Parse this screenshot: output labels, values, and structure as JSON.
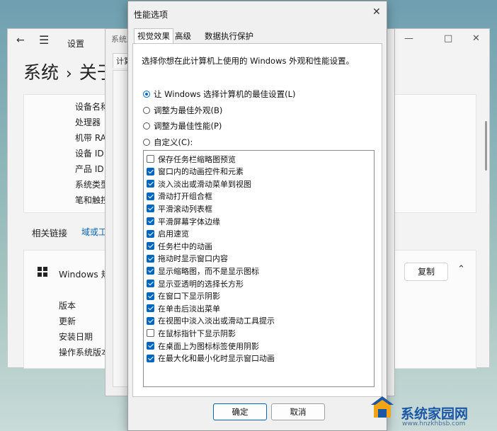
{
  "settings_window": {
    "app_title": "设置",
    "breadcrumb": [
      "系统",
      "关于"
    ],
    "spec_labels": [
      "设备名称",
      "处理器",
      "机带 RAM",
      "设备 ID",
      "产品 ID",
      "系统类型",
      "笔和触控"
    ],
    "related_label": "相关链接",
    "related_link": "域或工作组",
    "windows_spec_title": "Windows 规格",
    "copy_button": "复制",
    "windows_spec_labels": [
      "版本",
      "更新",
      "安装日期",
      "操作系统版本"
    ]
  },
  "system_properties": {
    "title": "系统属性",
    "tab": "计算机名"
  },
  "dialog": {
    "title": "性能选项",
    "tabs": [
      "视觉效果",
      "高级",
      "数据执行保护"
    ],
    "description": "选择你想在此计算机上使用的 Windows 外观和性能设置。",
    "radios": [
      {
        "label": "让 Windows 选择计算机的最佳设置(L)",
        "checked": true
      },
      {
        "label": "调整为最佳外观(B)",
        "checked": false
      },
      {
        "label": "调整为最佳性能(P)",
        "checked": false
      },
      {
        "label": "自定义(C):",
        "checked": false
      }
    ],
    "options": [
      {
        "label": "保存任务栏缩略图预览",
        "checked": false
      },
      {
        "label": "窗口内的动画控件和元素",
        "checked": true
      },
      {
        "label": "淡入淡出或滑动菜单到视图",
        "checked": true
      },
      {
        "label": "滑动打开组合框",
        "checked": true
      },
      {
        "label": "平滑滚动列表框",
        "checked": true
      },
      {
        "label": "平滑屏幕字体边缘",
        "checked": true
      },
      {
        "label": "启用速览",
        "checked": true
      },
      {
        "label": "任务栏中的动画",
        "checked": true
      },
      {
        "label": "拖动时显示窗口内容",
        "checked": true
      },
      {
        "label": "显示缩略图，而不是显示图标",
        "checked": true
      },
      {
        "label": "显示亚透明的选择长方形",
        "checked": true
      },
      {
        "label": "在窗口下显示阴影",
        "checked": true
      },
      {
        "label": "在单击后淡出菜单",
        "checked": true
      },
      {
        "label": "在视图中淡入淡出或滑动工具提示",
        "checked": true
      },
      {
        "label": "在鼠标指针下显示阴影",
        "checked": false
      },
      {
        "label": "在桌面上为图标标签使用阴影",
        "checked": true
      },
      {
        "label": "在最大化和最小化时显示窗口动画",
        "checked": true
      }
    ],
    "ok_button": "确定",
    "cancel_button": "取消"
  },
  "watermark": {
    "site_name": "系统家园网",
    "url": "www.hnzkhbsb.com"
  },
  "colors": {
    "accent": "#0067c0",
    "link": "#0a66b3"
  }
}
